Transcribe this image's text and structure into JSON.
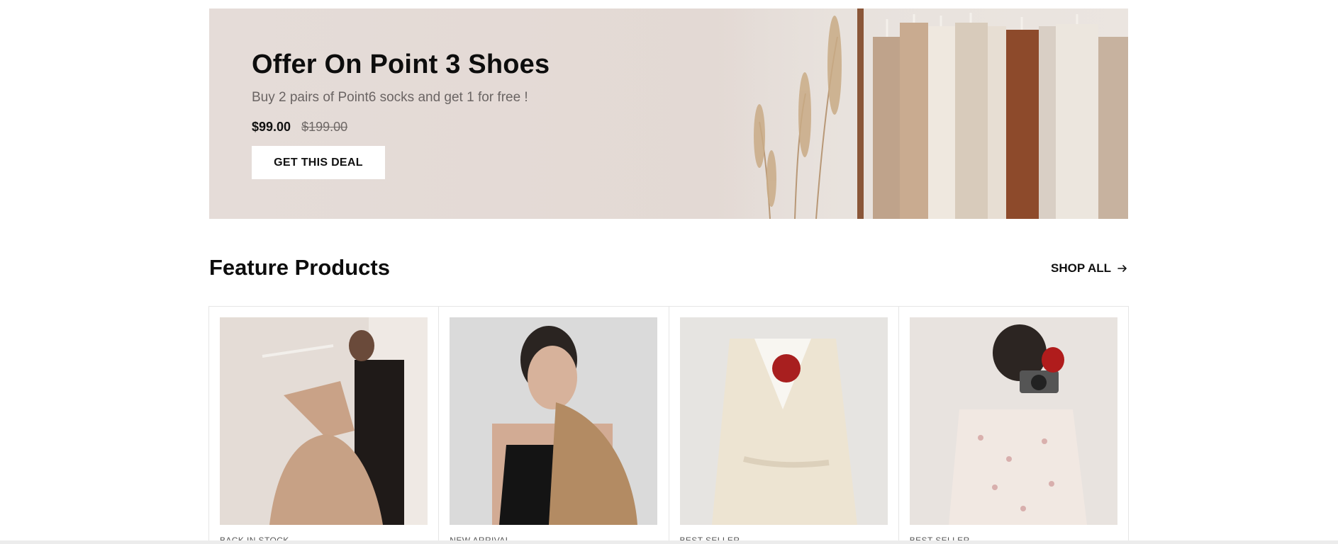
{
  "banner": {
    "title": "Offer On Point 3 Shoes",
    "subtitle": "Buy 2 pairs of Point6 socks and get 1 for free !",
    "price_now": "$99.00",
    "price_old": "$199.00",
    "cta_label": "GET THIS DEAL"
  },
  "section": {
    "title": "Feature Products",
    "shop_all_label": "SHOP ALL",
    "shop_all_icon": "arrow-right-icon"
  },
  "products": [
    {
      "badge": "BACK IN STOCK",
      "image": "woman-tulle-gown-photo"
    },
    {
      "badge": "NEW ARRIVAL",
      "image": "woman-black-camisole-photo"
    },
    {
      "badge": "BEST SELLER",
      "image": "cream-blazer-red-rose-photo"
    },
    {
      "badge": "BEST SELLER",
      "image": "woman-floral-dress-camera-photo"
    }
  ],
  "colors": {
    "banner_bg": "#e4dbd6",
    "text_dark": "#0d0d0d",
    "text_muted": "#6a6463",
    "button_bg": "#ffffff",
    "border": "#e6e6e6"
  }
}
